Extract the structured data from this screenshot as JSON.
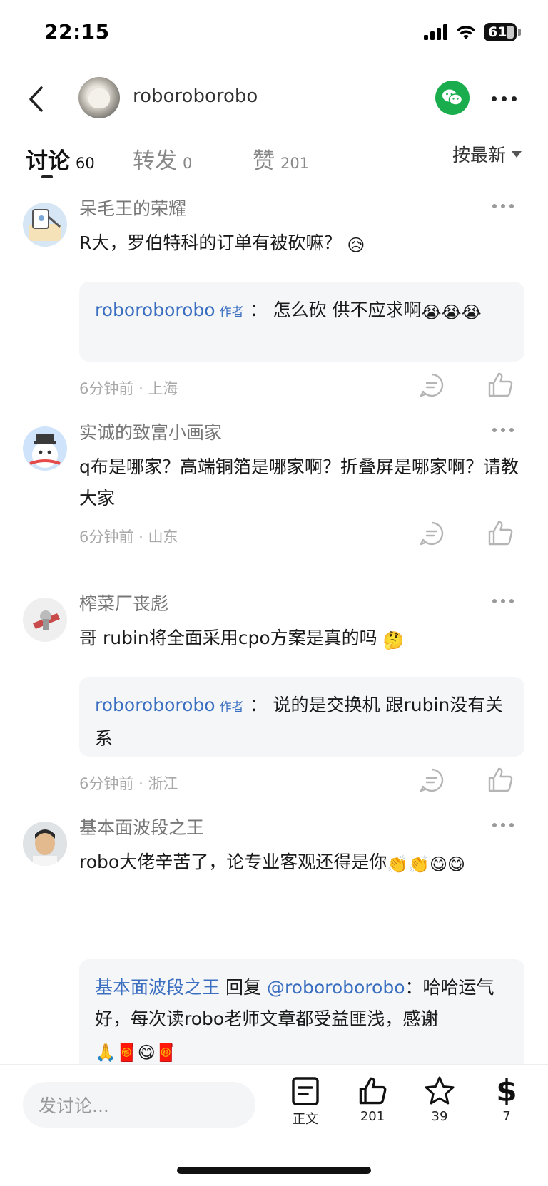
{
  "status_bar": {
    "time": "22:15",
    "battery": "61"
  },
  "nav": {
    "username": "roboroborobo"
  },
  "tabs": [
    {
      "label": "讨论",
      "count": "60"
    },
    {
      "label": "转发",
      "count": "0"
    },
    {
      "label": "赞",
      "count": "201"
    }
  ],
  "sort_label": "按最新",
  "comments": [
    {
      "user": "呆毛王的荣耀",
      "text": "R大，罗伯特科的订单有被砍嘛？",
      "emoji": "😥",
      "reply": {
        "author": "roboroborobo",
        "tag": "作者",
        "sep": "：",
        "text": "怎么砍 供不应求啊",
        "emoji": "😭😭😭"
      },
      "time": "6分钟前",
      "location": "上海"
    },
    {
      "user": "实诚的致富小画家",
      "text": "q布是哪家？高端铜箔是哪家啊？折叠屏是哪家啊？请教大家",
      "time": "6分钟前",
      "location": "山东"
    },
    {
      "user": "榨菜厂丧彪",
      "text": "哥 rubin将全面采用cpo方案是真的吗",
      "emoji": "🤔",
      "reply": {
        "author": "roboroborobo",
        "tag": "作者",
        "sep": "：",
        "text": "说的是交换机 跟rubin没有关系"
      },
      "time": "6分钟前",
      "location": "浙江"
    },
    {
      "user": "基本面波段之王",
      "text": "robo大佬辛苦了，论专业客观还得是你",
      "emoji": "👏👏😋😋",
      "reply": {
        "author": "基本面波段之王",
        "reply_word": "回复",
        "target": "@roboroborobo",
        "sep": "：",
        "text": "哈哈运气好，每次读robo老师文章都受益匪浅，感谢",
        "emoji": "🙏🧧😋🧧"
      }
    }
  ],
  "meta_separator": "·",
  "bottom_bar": {
    "input_placeholder": "发讨论...",
    "items": [
      {
        "label": "正文",
        "icon": "article-icon"
      },
      {
        "label": "201",
        "icon": "thumbs-up-icon"
      },
      {
        "label": "39",
        "icon": "star-icon"
      },
      {
        "label": "7",
        "icon": "dollar-icon",
        "glyph": "$"
      }
    ]
  }
}
